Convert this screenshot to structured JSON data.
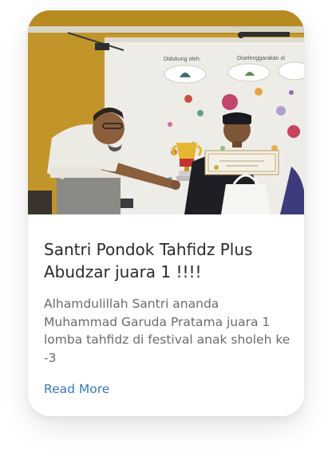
{
  "post": {
    "title": "Santri Pondok Tahfidz Plus Abudzar juara 1 !!!!",
    "excerpt": "Alhamdulillah Santri ananda Muhammad Garuda Pratama juara 1 lomba tahfidz di festival anak sholeh ke -3",
    "read_more": "Read More",
    "image": {
      "banner_supported_label": "Didukung oleh:",
      "banner_organized_label": "Diselenggarakan ol"
    }
  },
  "colors": {
    "link": "#3a78c2",
    "title": "#2a2a2a",
    "text": "#6b6b6b",
    "wall": "#c69a2a"
  }
}
